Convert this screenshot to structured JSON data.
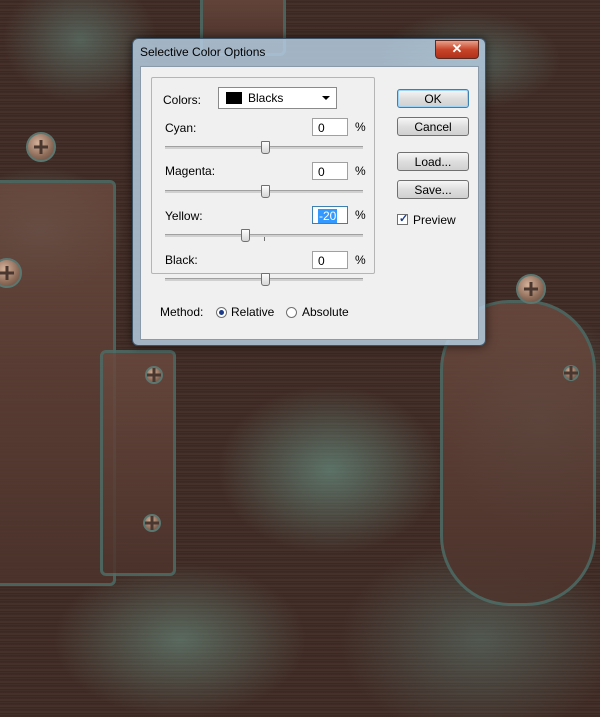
{
  "dialog": {
    "title": "Selective Color Options",
    "close_label": "✕",
    "colors_label": "Colors:",
    "colors_selected": "Blacks",
    "sliders": [
      {
        "label": "Cyan:",
        "value": "0",
        "unit": "%"
      },
      {
        "label": "Magenta:",
        "value": "0",
        "unit": "%"
      },
      {
        "label": "Yellow:",
        "value": "-20",
        "unit": "%"
      },
      {
        "label": "Black:",
        "value": "0",
        "unit": "%"
      }
    ],
    "slider_positions": [
      0,
      0,
      -20,
      0
    ],
    "buttons": {
      "ok": "OK",
      "cancel": "Cancel",
      "load": "Load...",
      "save": "Save..."
    },
    "preview_label": "Preview",
    "preview_checked": true,
    "method_label": "Method:",
    "method_options": [
      "Relative",
      "Absolute"
    ],
    "method_selected": "Relative"
  },
  "icons": {
    "close": "close-icon",
    "dropdown": "chevron-down-icon",
    "check": "check-icon"
  }
}
